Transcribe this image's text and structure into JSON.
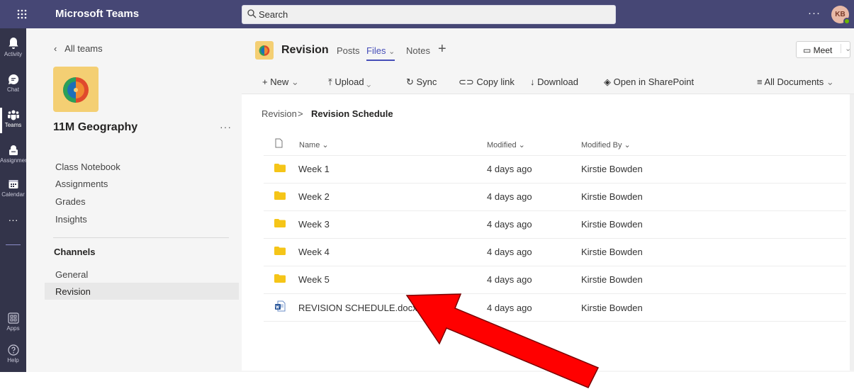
{
  "app": {
    "title": "Microsoft Teams",
    "search_placeholder": "Search",
    "more": "···",
    "user_initials": "KB"
  },
  "rail": {
    "items": [
      {
        "label": "Activity",
        "icon": "bell-icon"
      },
      {
        "label": "Chat",
        "icon": "chat-icon"
      },
      {
        "label": "Teams",
        "icon": "teams-icon"
      },
      {
        "label": "Assignments",
        "icon": "assignments-icon"
      },
      {
        "label": "Calendar",
        "icon": "calendar-icon"
      },
      {
        "label": "···",
        "icon": "more-icon"
      },
      {
        "label": "Apps",
        "icon": "apps-icon"
      },
      {
        "label": "Help",
        "icon": "help-icon"
      }
    ],
    "active": "Teams"
  },
  "team": {
    "back_label": "All teams",
    "name": "11M Geography",
    "more": "···",
    "nav": [
      "Class Notebook",
      "Assignments",
      "Grades",
      "Insights"
    ],
    "channels_heading": "Channels",
    "channels": [
      "General",
      "Revision"
    ],
    "selected_channel": "Revision"
  },
  "channel_header": {
    "title": "Revision",
    "tabs": [
      "Posts",
      "Files",
      "Notes"
    ],
    "active_tab": "Files",
    "files_chevron": "⌄",
    "add_tab": "+",
    "meet_label": "Meet",
    "meet_chevron": "⌄"
  },
  "toolbar": {
    "new": "New",
    "upload": "Upload",
    "sync": "Sync",
    "copy_link": "Copy link",
    "download": "Download",
    "open_sharepoint": "Open in SharePoint",
    "view": "All Documents"
  },
  "breadcrumb": {
    "root": "Revision",
    "separator": ">",
    "current": "Revision Schedule"
  },
  "table": {
    "columns": {
      "name": "Name",
      "modified": "Modified",
      "modified_by": "Modified By"
    },
    "sort_chevron": "⌄",
    "rows": [
      {
        "type": "folder",
        "name": "Week 1",
        "modified": "4 days ago",
        "modified_by": "Kirstie Bowden"
      },
      {
        "type": "folder",
        "name": "Week 2",
        "modified": "4 days ago",
        "modified_by": "Kirstie Bowden"
      },
      {
        "type": "folder",
        "name": "Week 3",
        "modified": "4 days ago",
        "modified_by": "Kirstie Bowden"
      },
      {
        "type": "folder",
        "name": "Week 4",
        "modified": "4 days ago",
        "modified_by": "Kirstie Bowden"
      },
      {
        "type": "folder",
        "name": "Week 5",
        "modified": "4 days ago",
        "modified_by": "Kirstie Bowden"
      },
      {
        "type": "word",
        "name": "REVISION SCHEDULE.docx",
        "modified": "4 days ago",
        "modified_by": "Kirstie Bowden"
      }
    ]
  },
  "colors": {
    "topbar": "#464775",
    "rail": "#33344a",
    "accent": "#464eb8",
    "folder": "#f5c518",
    "arrow": "#ff0000"
  }
}
